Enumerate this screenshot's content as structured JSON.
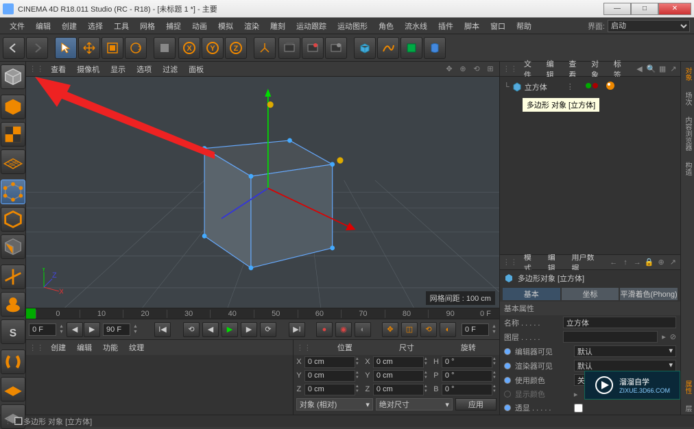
{
  "titlebar": {
    "title": "CINEMA 4D R18.011 Studio (RC - R18) - [未标题 1 *] - 主要"
  },
  "menubar": {
    "items": [
      "文件",
      "编辑",
      "创建",
      "选择",
      "工具",
      "网格",
      "捕捉",
      "动画",
      "模拟",
      "渲染",
      "雕刻",
      "运动跟踪",
      "运动图形",
      "角色",
      "流水线",
      "插件",
      "脚本",
      "窗口",
      "帮助"
    ],
    "layout_label": "界面:",
    "layout_value": "启动"
  },
  "viewport": {
    "menu": [
      "查看",
      "摄像机",
      "显示",
      "选项",
      "过滤",
      "面板"
    ],
    "grid_label": "网格间距 : 100 cm",
    "axes": {
      "x": "X",
      "y": "Y",
      "z": "Z"
    }
  },
  "timeline": {
    "ticks": [
      "0",
      "10",
      "20",
      "30",
      "40",
      "50",
      "60",
      "70",
      "80",
      "90"
    ],
    "end_label": "0 F"
  },
  "transport": {
    "start": "0 F",
    "end": "90 F",
    "current": "0 F"
  },
  "materials": {
    "menu": [
      "创建",
      "编辑",
      "功能",
      "纹理"
    ]
  },
  "coords": {
    "headers": [
      "位置",
      "尺寸",
      "旋转"
    ],
    "rows": [
      {
        "axis": "X",
        "pos": "0 cm",
        "size": "0 cm",
        "rotlbl": "H",
        "rot": "0 °"
      },
      {
        "axis": "Y",
        "pos": "0 cm",
        "size": "0 cm",
        "rotlbl": "P",
        "rot": "0 °"
      },
      {
        "axis": "Z",
        "pos": "0 cm",
        "size": "0 cm",
        "rotlbl": "B",
        "rot": "0 °"
      }
    ],
    "mode": "对象 (相对)",
    "sizemode": "绝对尺寸",
    "apply": "应用"
  },
  "objmgr": {
    "menu": [
      "文件",
      "编辑",
      "查看",
      "对象",
      "标签"
    ],
    "item": "立方体",
    "tooltip": "多边形 对象 [立方体]"
  },
  "attr": {
    "menu": [
      "模式",
      "编辑",
      "用户数据"
    ],
    "title": "多边形对象 [立方体]",
    "tabs": [
      "基本",
      "坐标",
      "平滑着色(Phong)"
    ],
    "section": "基本属性",
    "props": {
      "name_label": "名称 . . . . .",
      "name_value": "立方体",
      "layer_label": "图层 . . . . .",
      "ed_label": "编辑器可见",
      "ed_value": "默认",
      "rd_label": "渲染器可见",
      "rd_value": "默认",
      "color_label": "使用颜色",
      "color_value": "关闭",
      "disp_label": "显示颜色",
      "xray_label": "透显 . . . . ."
    }
  },
  "farright": {
    "tabs": [
      "对象",
      "场次",
      "内容浏览器",
      "构造",
      "属性",
      "层"
    ]
  },
  "statusbar": {
    "text": "多边形 对象 [立方体]"
  },
  "watermark": {
    "text": "溜溜自学",
    "url": "ZIXUE.3D66.COM"
  }
}
